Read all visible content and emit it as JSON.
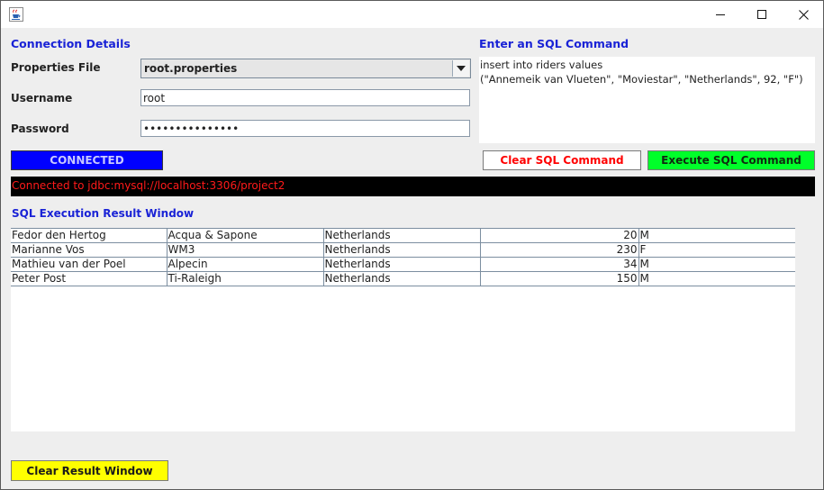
{
  "window": {
    "title": "",
    "app_icon": "java-cup-icon",
    "controls": [
      "minimize-icon",
      "maximize-icon",
      "close-icon"
    ]
  },
  "connection": {
    "heading": "Connection Details",
    "properties_label": "Properties File",
    "properties_value": "root.properties",
    "username_label": "Username",
    "username_value": "root",
    "password_label": "Password",
    "password_value": "•••••••••••••••"
  },
  "sql": {
    "heading": "Enter an SQL Command",
    "command": "insert into riders values\n(\"Annemeik van Vlueten\", \"Moviestar\", \"Netherlands\", 92, \"F\")",
    "clear_label": "Clear SQL Command",
    "execute_label": "Execute SQL Command"
  },
  "status": {
    "label": "CONNECTED",
    "message": "Connected to jdbc:mysql://localhost:3306/project2"
  },
  "results": {
    "heading": "SQL Execution Result Window",
    "rows": [
      [
        "Fedor den Hertog",
        "Acqua & Sapone",
        "Netherlands",
        "20",
        "M"
      ],
      [
        "Marianne Vos",
        "WM3",
        "Netherlands",
        "230",
        "F"
      ],
      [
        "Mathieu van der Poel",
        "Alpecin",
        "Netherlands",
        "34",
        "M"
      ],
      [
        "Peter Post",
        "Ti-Raleigh",
        "Netherlands",
        "150",
        "M"
      ]
    ],
    "clear_label": "Clear Result Window"
  },
  "colors": {
    "heading_blue": "#1a23d6",
    "connected_bg": "#0000ff",
    "clear_sql_text": "#ff0000",
    "execute_bg": "#00ff2a",
    "status_text": "#ff1a1a",
    "clear_result_bg": "#ffff00"
  }
}
